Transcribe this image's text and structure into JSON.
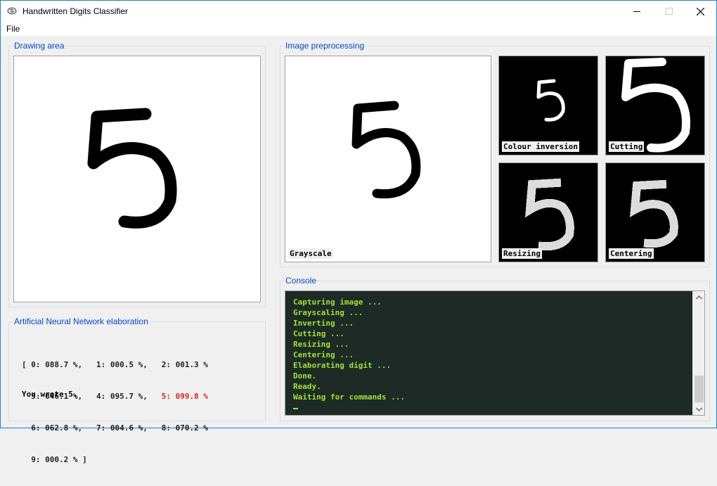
{
  "window": {
    "title": "Handwritten Digits Classifier"
  },
  "menu": {
    "file": "File"
  },
  "drawing": {
    "label": "Drawing area",
    "digit": "5"
  },
  "preprocessing": {
    "label": "Image preprocessing",
    "grayscale_label": "Grayscale",
    "thumbs": [
      {
        "label": "Colour inversion",
        "digit": "5"
      },
      {
        "label": "Cutting",
        "digit": "5"
      },
      {
        "label": "Resizing",
        "digit": "5"
      },
      {
        "label": "Centering",
        "digit": "5"
      }
    ]
  },
  "ann": {
    "label": "Artificial Neural Network elaboration",
    "rows": [
      [
        "[ 0: 088.7 %,",
        "1: 000.5 %,",
        "2: 001.3 %"
      ],
      [
        "  3: 046.1 %,",
        "4: 095.7 %,",
        "5: 099.8 %"
      ],
      [
        "  6: 062.8 %,",
        "7: 004.6 %,",
        "8: 070.2 %"
      ],
      [
        "  9: 000.2 % ]",
        "",
        ""
      ]
    ],
    "highlight": {
      "row": 1,
      "col": 2
    },
    "result": "You wrote 5."
  },
  "console": {
    "label": "Console",
    "lines": [
      "Capturing image ...",
      "Grayscaling ...",
      "Inverting ...",
      "Cutting ...",
      "Resizing ...",
      "Centering ...",
      "Elaborating digit ...",
      "Done.",
      "Ready.",
      "Waiting for commands ..."
    ]
  },
  "colors": {
    "accent": "#0046d5",
    "console_bg": "#1e2a26",
    "console_fg": "#9ee62c",
    "highlight": "#e02020"
  }
}
